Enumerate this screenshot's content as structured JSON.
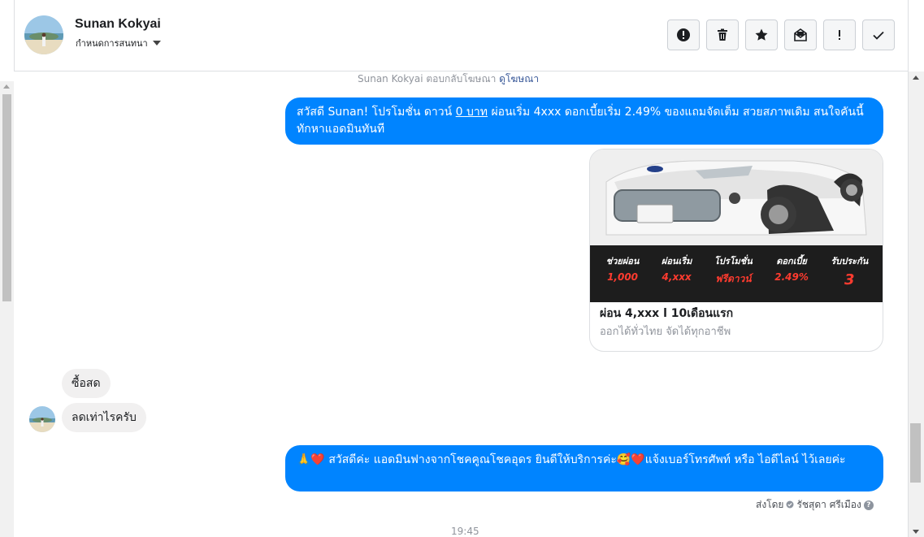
{
  "header": {
    "contact_name": "Sunan Kokyai",
    "stage_label": "กำหนดการสนทนา",
    "actions": [
      {
        "icon": "alert-circle-icon",
        "label": "Mark as spam"
      },
      {
        "icon": "trash-icon",
        "label": "Delete"
      },
      {
        "icon": "star-icon",
        "label": "Star"
      },
      {
        "icon": "mail-icon",
        "label": "Mark as unread"
      },
      {
        "icon": "exclamation-icon",
        "label": "Follow up"
      },
      {
        "icon": "check-icon",
        "label": "Done"
      }
    ]
  },
  "conversation": {
    "reply_note": {
      "text": "Sunan Kokyai ตอบกลับโฆษณา",
      "link": "ดูโฆษณา"
    },
    "messages": [
      {
        "direction": "outgoing",
        "text_before": "สวัสดี Sunan! โปรโมชั่น ดาวน์ ",
        "underlined": "0 บาท",
        "text_after": " ผ่อนเริ่ม 4xxx ดอกเบี้ยเริ่ม 2.49% ของแถมจัดเต็ม สวยสภาพเดิม สนใจคันนี้ทักหาแอดมินทันที"
      },
      {
        "direction": "incoming",
        "text": "ซื้อสด"
      },
      {
        "direction": "incoming",
        "text": "ลดเท่าไรครับ"
      },
      {
        "direction": "outgoing",
        "text": "🙏❤️ สวัสดีค่ะ แอดมินฟางจากโชคคูณโชคอุดร ยินดีให้บริการค่ะ🥰❤️แจ้งเบอร์โทรศัพท์ หรือ ไอดีไลน์  ไว้เลยค่ะ"
      }
    ],
    "ad_card": {
      "promos": [
        {
          "label": "ช่วยผ่อน",
          "value": "1,000"
        },
        {
          "label": "ผ่อนเริ่ม",
          "value": "4,xxx"
        },
        {
          "label": "โปรโมชั่น",
          "value": "ฟรีดาวน์"
        },
        {
          "label": "ดอกเบี้ย",
          "value": "2.49%"
        },
        {
          "label": "รับประกัน",
          "value": "3"
        }
      ],
      "title": "ผ่อน 4,xxx l 10เดือนแรก",
      "subtitle": "ออกได้ทั่วไทย จัดได้ทุกอาชีพ"
    },
    "sent_by": {
      "prefix": "ส่งโดย",
      "name": "รัชสุดา ศรีเมือง",
      "help": "?"
    },
    "timestamp": "19:45"
  },
  "colors": {
    "outgoing_bubble": "#0084ff",
    "incoming_bubble": "#f1f0f0",
    "link": "#385898"
  }
}
